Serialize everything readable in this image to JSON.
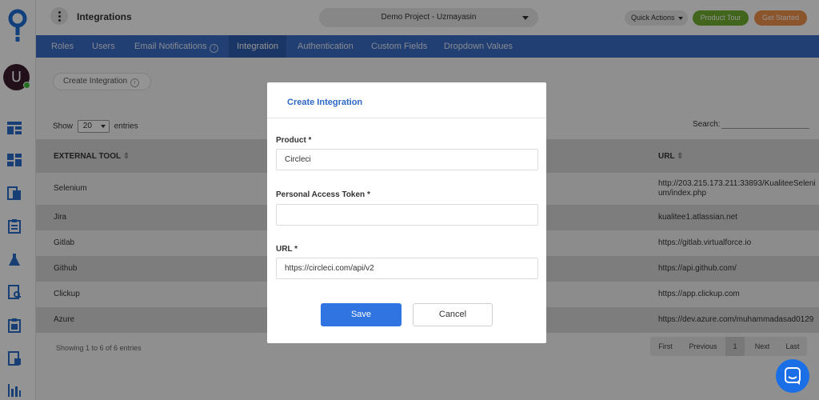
{
  "header": {
    "title": "Integrations",
    "project": "Demo Project - Uzmayasin",
    "quick_actions": "Quick Actions",
    "product_tour": "Product Tour",
    "get_started": "Get Started"
  },
  "user": {
    "initial": "U"
  },
  "sidebar": {
    "icons": [
      "dashboard-icon",
      "modules-icon",
      "test-cases-icon",
      "test-plan-icon",
      "lab-icon",
      "reports-icon",
      "documents-icon",
      "defects-icon",
      "analytics-icon"
    ]
  },
  "nav": {
    "tabs": [
      {
        "label": "Roles"
      },
      {
        "label": "Users"
      },
      {
        "label": "Email Notifications"
      },
      {
        "label": "Integration"
      },
      {
        "label": "Authentication"
      },
      {
        "label": "Custom Fields"
      },
      {
        "label": "Dropdown Values"
      }
    ],
    "active": "Integration"
  },
  "content": {
    "create_button": "Create Integration",
    "show_label": "Show",
    "entries_value": "20",
    "entries_label": "entries",
    "search_label": "Search:",
    "table": {
      "columns": [
        "EXTERNAL TOOL",
        "URL"
      ],
      "rows": [
        {
          "tool": "Selenium",
          "url": "http://203.215.173.211:33893/KualiteeSelenium/index.php"
        },
        {
          "tool": "Jira",
          "url": "kualitee1.atlassian.net"
        },
        {
          "tool": "Gitlab",
          "url": "https://gitlab.virtualforce.io"
        },
        {
          "tool": "Github",
          "url": "https://api.github.com/"
        },
        {
          "tool": "Clickup",
          "url": "https://app.clickup.com"
        },
        {
          "tool": "Azure",
          "url": "https://dev.azure.com/muhammadasad0129"
        }
      ]
    },
    "showing_text": "Showing 1 to 6 of 6 entries",
    "pagination": {
      "first": "First",
      "previous": "Previous",
      "current": "1",
      "next": "Next",
      "last": "Last"
    }
  },
  "modal": {
    "title": "Create Integration",
    "product_label": "Product *",
    "product_value": "Circleci",
    "token_label": "Personal Access Token *",
    "token_value": "",
    "url_label": "URL *",
    "url_value": "https://circleci.com/api/v2",
    "save": "Save",
    "cancel": "Cancel"
  },
  "colors": {
    "nav_bg": "#3a6dc4",
    "primary": "#2f74e0",
    "product_tour": "#6fae2f",
    "get_started": "#f0924a",
    "chat": "#1b6fe6"
  }
}
